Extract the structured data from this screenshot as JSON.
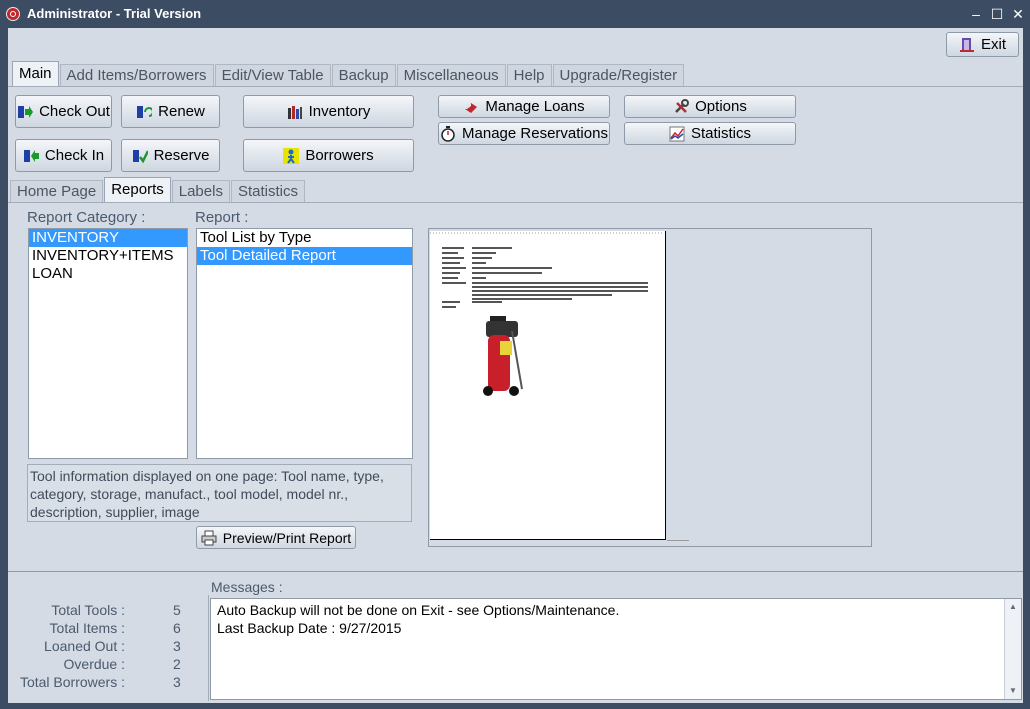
{
  "window": {
    "title": "Administrator - Trial Version"
  },
  "top_actions": {
    "exit_label": "Exit"
  },
  "main_tabs": [
    {
      "label": "Main"
    },
    {
      "label": "Add Items/Borrowers"
    },
    {
      "label": "Edit/View Table"
    },
    {
      "label": "Backup"
    },
    {
      "label": "Miscellaneous"
    },
    {
      "label": "Help"
    },
    {
      "label": "Upgrade/Register"
    }
  ],
  "toolbar": {
    "check_out": "Check Out",
    "renew": "Renew",
    "inventory": "Inventory",
    "check_in": "Check In",
    "reserve": "Reserve",
    "borrowers": "Borrowers",
    "manage_loans": "Manage Loans",
    "manage_reservations": "Manage Reservations",
    "options": "Options",
    "statistics": "Statistics"
  },
  "sub_tabs": [
    {
      "label": "Home Page"
    },
    {
      "label": "Reports"
    },
    {
      "label": "Labels"
    },
    {
      "label": "Statistics"
    }
  ],
  "reports": {
    "category_label": "Report Category :",
    "categories": [
      "INVENTORY",
      "INVENTORY+ITEMS",
      "LOAN"
    ],
    "report_label": "Report :",
    "reports": [
      "Tool List by Type",
      "Tool Detailed Report"
    ],
    "description": "Tool information displayed on one page: Tool name, type, category, storage, manufact., tool model, model nr., description, supplier, image",
    "preview_button": "Preview/Print Report"
  },
  "stats": {
    "total_tools_label": "Total Tools :",
    "total_tools": "5",
    "total_items_label": "Total Items :",
    "total_items": "6",
    "loaned_out_label": "Loaned Out :",
    "loaned_out": "3",
    "overdue_label": "Overdue :",
    "overdue": "2",
    "total_borrowers_label": "Total Borrowers :",
    "total_borrowers": "3"
  },
  "messages": {
    "label": "Messages :",
    "line1": "Auto Backup will not be done on Exit - see Options/Maintenance.",
    "line2": "Last Backup Date : 9/27/2015"
  },
  "colors": {
    "selection": "#3399ff",
    "title_bar": "#3c4d63",
    "client_bg": "#d4dbe4"
  }
}
